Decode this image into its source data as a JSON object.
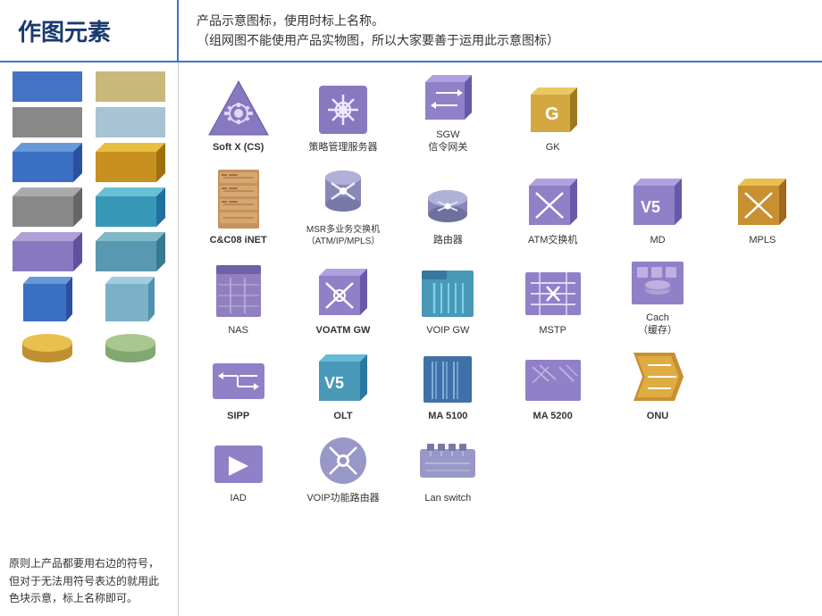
{
  "header": {
    "title": "作图元素",
    "desc_line1": "产品示意图标，使用时标上名称。",
    "desc_line2": "（组网图不能使用产品实物图，所以大家要善于运用此示意图标）"
  },
  "left_panel": {
    "bottom_text": "原则上产品都要用右边的符号，但对于无法用符号表达的就用此色块示意，标上名称即可。"
  },
  "icons": [
    {
      "id": "softx",
      "label": "Soft X (CS)",
      "bold": true
    },
    {
      "id": "policy_server",
      "label": "策略管理服务器",
      "bold": false
    },
    {
      "id": "sgw",
      "label": "SGW\n信令网关",
      "bold": false
    },
    {
      "id": "gk",
      "label": "GK",
      "bold": false
    },
    {
      "id": "empty1",
      "label": "",
      "bold": false
    },
    {
      "id": "empty2",
      "label": "",
      "bold": false
    },
    {
      "id": "cc08",
      "label": "C&C08 iNET",
      "bold": true
    },
    {
      "id": "msr",
      "label": "MSR多业务交换机\n（ATM/IP/MPLS）",
      "bold": false
    },
    {
      "id": "router",
      "label": "路由器",
      "bold": false
    },
    {
      "id": "atm",
      "label": "ATM交换机",
      "bold": false
    },
    {
      "id": "md",
      "label": "MD",
      "bold": false
    },
    {
      "id": "mpls",
      "label": "MPLS",
      "bold": false
    },
    {
      "id": "nas",
      "label": "NAS",
      "bold": false
    },
    {
      "id": "voatm",
      "label": "VOATM GW",
      "bold": true
    },
    {
      "id": "voip_gw",
      "label": "VOIP GW",
      "bold": false
    },
    {
      "id": "mstp",
      "label": "MSTP",
      "bold": false
    },
    {
      "id": "cach",
      "label": "Cach\n（缓存）",
      "bold": false
    },
    {
      "id": "empty3",
      "label": "",
      "bold": false
    },
    {
      "id": "sipp",
      "label": "SIPP",
      "bold": true
    },
    {
      "id": "olt",
      "label": "OLT",
      "bold": true
    },
    {
      "id": "ma5100",
      "label": "MA 5100",
      "bold": true
    },
    {
      "id": "ma5200",
      "label": "MA 5200",
      "bold": true
    },
    {
      "id": "onu",
      "label": "ONU",
      "bold": true
    },
    {
      "id": "empty4",
      "label": "",
      "bold": false
    },
    {
      "id": "iad",
      "label": "IAD",
      "bold": false
    },
    {
      "id": "voip_router",
      "label": "VOIP功能路由器",
      "bold": false
    },
    {
      "id": "lan_switch",
      "label": "Lan switch",
      "bold": false
    },
    {
      "id": "empty5",
      "label": "",
      "bold": false
    },
    {
      "id": "empty6",
      "label": "",
      "bold": false
    },
    {
      "id": "empty7",
      "label": "",
      "bold": false
    }
  ],
  "colors": {
    "blue_flat": "#4472c4",
    "tan_flat": "#d4c08a",
    "gray_flat": "#a0a0a0",
    "lightblue_flat": "#b8d4e8",
    "green_flat": "#c0d8b0",
    "blue3d_front": "#3a6fc4",
    "blue3d_top": "#6898d8",
    "yellow3d_front": "#d4a020",
    "yellow3d_top": "#e8c840",
    "gray3d_front": "#888888",
    "gray3d_top": "#aaaaaa",
    "purple3d_front": "#9080c0",
    "purple3d_top": "#b0a0d8",
    "cyan3d_front": "#40a0c0",
    "cyan3d_top": "#70c4d8"
  }
}
